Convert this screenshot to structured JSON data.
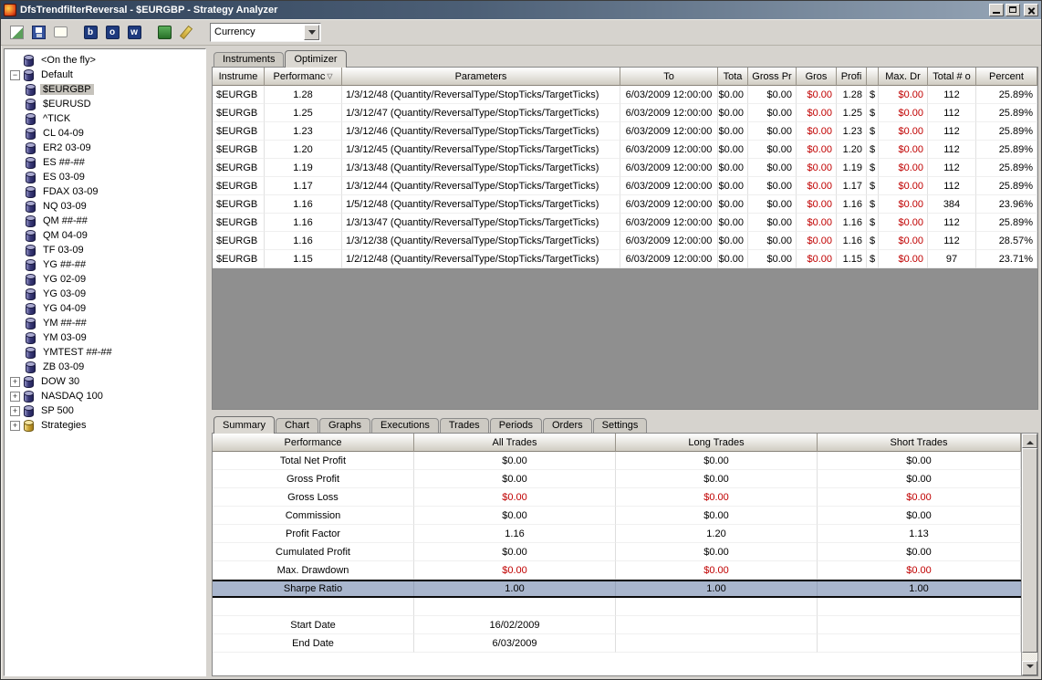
{
  "window": {
    "title": "DfsTrendfilterReversal - $EURGBP - Strategy Analyzer",
    "controls": [
      "minimize",
      "maximize",
      "close"
    ]
  },
  "toolbar": {
    "buttons": [
      {
        "name": "new-chart-icon"
      },
      {
        "name": "save-icon"
      },
      {
        "name": "comment-icon"
      },
      {
        "name": "letter-b-icon",
        "glyph": "b"
      },
      {
        "name": "letter-o-icon",
        "glyph": "o"
      },
      {
        "name": "letter-w-icon",
        "glyph": "w"
      },
      {
        "name": "run-icon"
      },
      {
        "name": "edit-icon"
      }
    ],
    "dropdown_value": "Currency"
  },
  "tree": {
    "items": [
      {
        "label": "<On the fly>",
        "depth": 0,
        "icon": "instrument-list"
      },
      {
        "label": "Default",
        "depth": 0,
        "expander": "minus",
        "icon": "instrument-list"
      },
      {
        "label": "$EURGBP",
        "depth": 1,
        "icon": "instrument",
        "selected": true
      },
      {
        "label": "$EURUSD",
        "depth": 1,
        "icon": "instrument"
      },
      {
        "label": "^TICK",
        "depth": 1,
        "icon": "instrument"
      },
      {
        "label": "CL 04-09",
        "depth": 1,
        "icon": "instrument"
      },
      {
        "label": "ER2 03-09",
        "depth": 1,
        "icon": "instrument"
      },
      {
        "label": "ES ##-##",
        "depth": 1,
        "icon": "instrument"
      },
      {
        "label": "ES 03-09",
        "depth": 1,
        "icon": "instrument"
      },
      {
        "label": "FDAX 03-09",
        "depth": 1,
        "icon": "instrument"
      },
      {
        "label": "NQ 03-09",
        "depth": 1,
        "icon": "instrument"
      },
      {
        "label": "QM ##-##",
        "depth": 1,
        "icon": "instrument"
      },
      {
        "label": "QM 04-09",
        "depth": 1,
        "icon": "instrument"
      },
      {
        "label": "TF 03-09",
        "depth": 1,
        "icon": "instrument"
      },
      {
        "label": "YG ##-##",
        "depth": 1,
        "icon": "instrument"
      },
      {
        "label": "YG 02-09",
        "depth": 1,
        "icon": "instrument"
      },
      {
        "label": "YG 03-09",
        "depth": 1,
        "icon": "instrument"
      },
      {
        "label": "YG 04-09",
        "depth": 1,
        "icon": "instrument"
      },
      {
        "label": "YM ##-##",
        "depth": 1,
        "icon": "instrument"
      },
      {
        "label": "YM 03-09",
        "depth": 1,
        "icon": "instrument"
      },
      {
        "label": "YMTEST ##-##",
        "depth": 1,
        "icon": "instrument"
      },
      {
        "label": "ZB 03-09",
        "depth": 1,
        "icon": "instrument"
      },
      {
        "label": "DOW 30",
        "depth": 0,
        "expander": "plus",
        "icon": "instrument-list"
      },
      {
        "label": "NASDAQ 100",
        "depth": 0,
        "expander": "plus",
        "icon": "instrument-list"
      },
      {
        "label": "SP 500",
        "depth": 0,
        "expander": "plus",
        "icon": "instrument-list"
      },
      {
        "label": "Strategies",
        "depth": 0,
        "expander": "plus",
        "icon": "strategies"
      }
    ]
  },
  "main_tabs": [
    {
      "label": "Instruments"
    },
    {
      "label": "Optimizer",
      "active": true
    }
  ],
  "optimizer_table": {
    "columns": [
      {
        "label": "Instrume"
      },
      {
        "label": "Performanc",
        "sort": "desc"
      },
      {
        "label": "Parameters"
      },
      {
        "label": "To"
      },
      {
        "label": "Tota"
      },
      {
        "label": "Gross Pr"
      },
      {
        "label": "Gros",
        "red": true
      },
      {
        "label": "Profi"
      },
      {
        "label": ""
      },
      {
        "label": "Max. Dr",
        "red": true
      },
      {
        "label": "Total # o"
      },
      {
        "label": "Percent"
      }
    ],
    "rows": [
      [
        "$EURGB",
        "1.28",
        "1/3/12/48 (Quantity/ReversalType/StopTicks/TargetTicks)",
        "6/03/2009 12:00:00",
        "$0.00",
        "$0.00",
        "$0.00",
        "1.28",
        "$",
        "$0.00",
        "112",
        "25.89%"
      ],
      [
        "$EURGB",
        "1.25",
        "1/3/12/47 (Quantity/ReversalType/StopTicks/TargetTicks)",
        "6/03/2009 12:00:00",
        "$0.00",
        "$0.00",
        "$0.00",
        "1.25",
        "$",
        "$0.00",
        "112",
        "25.89%"
      ],
      [
        "$EURGB",
        "1.23",
        "1/3/12/46 (Quantity/ReversalType/StopTicks/TargetTicks)",
        "6/03/2009 12:00:00",
        "$0.00",
        "$0.00",
        "$0.00",
        "1.23",
        "$",
        "$0.00",
        "112",
        "25.89%"
      ],
      [
        "$EURGB",
        "1.20",
        "1/3/12/45 (Quantity/ReversalType/StopTicks/TargetTicks)",
        "6/03/2009 12:00:00",
        "$0.00",
        "$0.00",
        "$0.00",
        "1.20",
        "$",
        "$0.00",
        "112",
        "25.89%"
      ],
      [
        "$EURGB",
        "1.19",
        "1/3/13/48 (Quantity/ReversalType/StopTicks/TargetTicks)",
        "6/03/2009 12:00:00",
        "$0.00",
        "$0.00",
        "$0.00",
        "1.19",
        "$",
        "$0.00",
        "112",
        "25.89%"
      ],
      [
        "$EURGB",
        "1.17",
        "1/3/12/44 (Quantity/ReversalType/StopTicks/TargetTicks)",
        "6/03/2009 12:00:00",
        "$0.00",
        "$0.00",
        "$0.00",
        "1.17",
        "$",
        "$0.00",
        "112",
        "25.89%"
      ],
      [
        "$EURGB",
        "1.16",
        "1/5/12/48 (Quantity/ReversalType/StopTicks/TargetTicks)",
        "6/03/2009 12:00:00",
        "$0.00",
        "$0.00",
        "$0.00",
        "1.16",
        "$",
        "$0.00",
        "384",
        "23.96%"
      ],
      [
        "$EURGB",
        "1.16",
        "1/3/13/47 (Quantity/ReversalType/StopTicks/TargetTicks)",
        "6/03/2009 12:00:00",
        "$0.00",
        "$0.00",
        "$0.00",
        "1.16",
        "$",
        "$0.00",
        "112",
        "25.89%"
      ],
      [
        "$EURGB",
        "1.16",
        "1/3/12/38 (Quantity/ReversalType/StopTicks/TargetTicks)",
        "6/03/2009 12:00:00",
        "$0.00",
        "$0.00",
        "$0.00",
        "1.16",
        "$",
        "$0.00",
        "112",
        "28.57%"
      ],
      [
        "$EURGB",
        "1.15",
        "1/2/12/48 (Quantity/ReversalType/StopTicks/TargetTicks)",
        "6/03/2009 12:00:00",
        "$0.00",
        "$0.00",
        "$0.00",
        "1.15",
        "$",
        "$0.00",
        "97",
        "23.71%"
      ]
    ]
  },
  "bottom_tabs": [
    {
      "label": "Summary",
      "active": true
    },
    {
      "label": "Chart"
    },
    {
      "label": "Graphs"
    },
    {
      "label": "Executions"
    },
    {
      "label": "Trades"
    },
    {
      "label": "Periods"
    },
    {
      "label": "Orders"
    },
    {
      "label": "Settings"
    }
  ],
  "summary_table": {
    "columns": [
      "Performance",
      "All Trades",
      "Long Trades",
      "Short Trades"
    ],
    "rows": [
      {
        "label": "Total Net Profit",
        "values": [
          "$0.00",
          "$0.00",
          "$0.00"
        ]
      },
      {
        "label": "Gross Profit",
        "values": [
          "$0.00",
          "$0.00",
          "$0.00"
        ]
      },
      {
        "label": "Gross Loss",
        "values": [
          "$0.00",
          "$0.00",
          "$0.00"
        ],
        "red": true
      },
      {
        "label": "Commission",
        "values": [
          "$0.00",
          "$0.00",
          "$0.00"
        ]
      },
      {
        "label": "Profit Factor",
        "values": [
          "1.16",
          "1.20",
          "1.13"
        ]
      },
      {
        "label": "Cumulated Profit",
        "values": [
          "$0.00",
          "$0.00",
          "$0.00"
        ]
      },
      {
        "label": "Max. Drawdown",
        "values": [
          "$0.00",
          "$0.00",
          "$0.00"
        ],
        "red": true
      },
      {
        "label": "Sharpe Ratio",
        "values": [
          "1.00",
          "1.00",
          "1.00"
        ],
        "selected": true
      },
      {
        "label": "",
        "values": [
          "",
          "",
          ""
        ]
      },
      {
        "label": "Start Date",
        "values": [
          "16/02/2009",
          "",
          ""
        ]
      },
      {
        "label": "End Date",
        "values": [
          "6/03/2009",
          "",
          ""
        ]
      }
    ]
  },
  "colors": {
    "negative_text": "#c00000",
    "selected_row_bg": "#a9b6cd",
    "titlebar_gradient_start": "#2e4058",
    "titlebar_gradient_end": "#97a6b7",
    "grid_empty_fill": "#8f8f8f"
  }
}
